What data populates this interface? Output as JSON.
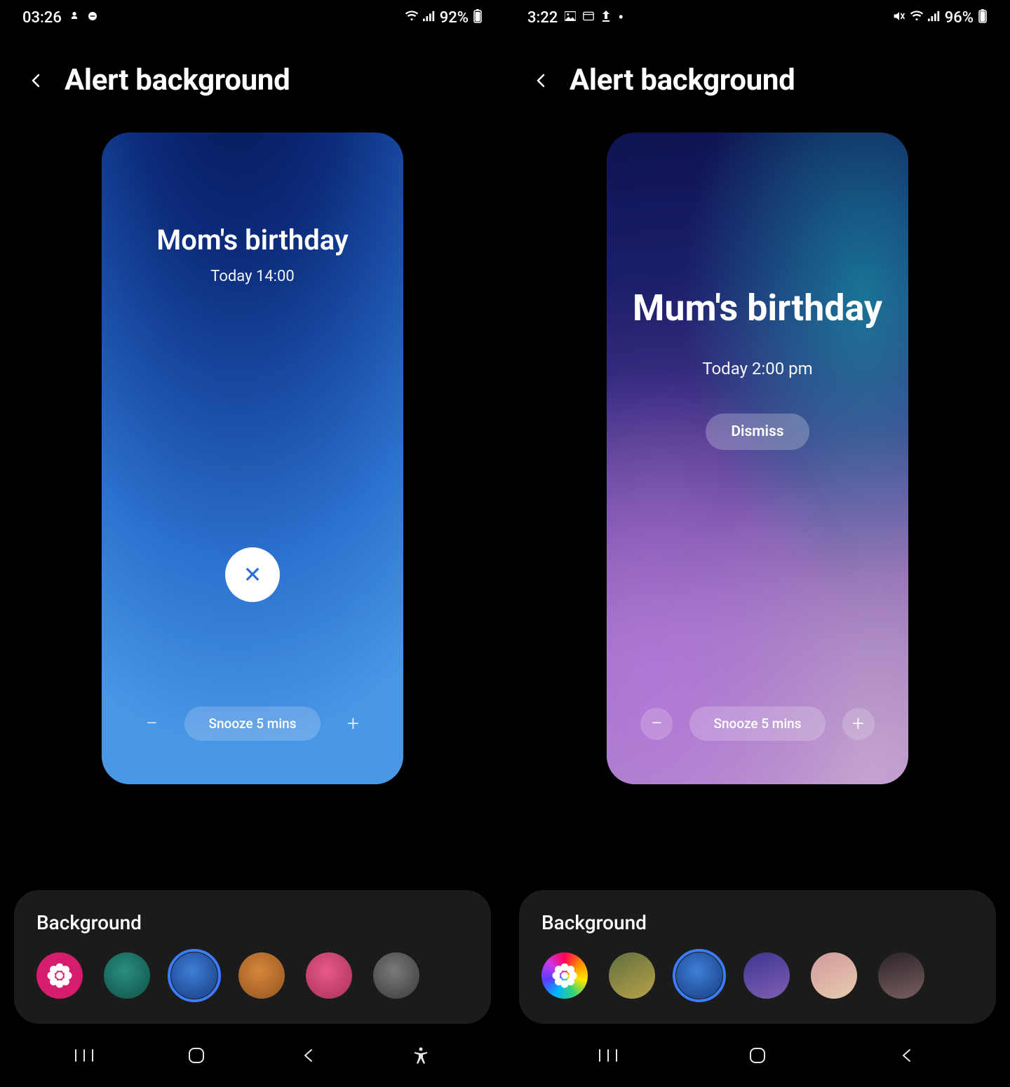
{
  "left": {
    "status": {
      "time": "03:26",
      "battery": "92%"
    },
    "header_title": "Alert background",
    "alert": {
      "title": "Mom's birthday",
      "time": "Today 14:00",
      "snooze_label": "Snooze 5 mins"
    },
    "palette": {
      "title": "Background",
      "swatches": [
        {
          "name": "gallery-flower",
          "color": "#d61c6f",
          "selected": false,
          "is_gallery": true
        },
        {
          "name": "teal-green",
          "gradient": "radial-gradient(circle at 45% 40%, #2a8f80 0%, #0f4f46 100%)"
        },
        {
          "name": "blue",
          "gradient": "radial-gradient(circle at 45% 40%, #3f7fd6 0%, #163a80 100%)",
          "selected": true
        },
        {
          "name": "orange",
          "gradient": "radial-gradient(circle at 45% 40%, #d8873a 0%, #8f5320 100%)"
        },
        {
          "name": "pink",
          "gradient": "radial-gradient(circle at 45% 40%, #e85a88 0%, #a82f5c 100%)"
        },
        {
          "name": "grey",
          "gradient": "radial-gradient(circle at 45% 40%, #7a7a7a 0%, #3a3a3a 100%)"
        }
      ]
    }
  },
  "right": {
    "status": {
      "time": "3:22",
      "battery": "96%"
    },
    "header_title": "Alert background",
    "alert": {
      "title": "Mum's birthday",
      "time": "Today 2:00 pm",
      "dismiss_label": "Dismiss",
      "snooze_label": "Snooze 5 mins"
    },
    "palette": {
      "title": "Background",
      "swatches": [
        {
          "name": "gallery-rainbow",
          "gradient": "conic-gradient(#ff0055,#ff8a00,#ffe600,#33d17a,#00b3ff,#5a3cff,#c839e8,#ff0055)",
          "is_gallery": true
        },
        {
          "name": "olive-yellow",
          "gradient": "linear-gradient(150deg,#5f6f3e 0%, #b9a24a 100%)"
        },
        {
          "name": "blue",
          "gradient": "radial-gradient(circle at 45% 40%, #3f7fd6 0%, #163a80 100%)",
          "selected": true
        },
        {
          "name": "violet",
          "gradient": "linear-gradient(160deg,#3f3590 0%, #7e5fb3 100%)"
        },
        {
          "name": "rose-beige",
          "gradient": "linear-gradient(155deg,#d09a9a 0%, #e8cbb0 100%)"
        },
        {
          "name": "dark-mauve",
          "gradient": "linear-gradient(165deg,#2b2428 0%, #7a5e60 100%)"
        }
      ]
    }
  }
}
